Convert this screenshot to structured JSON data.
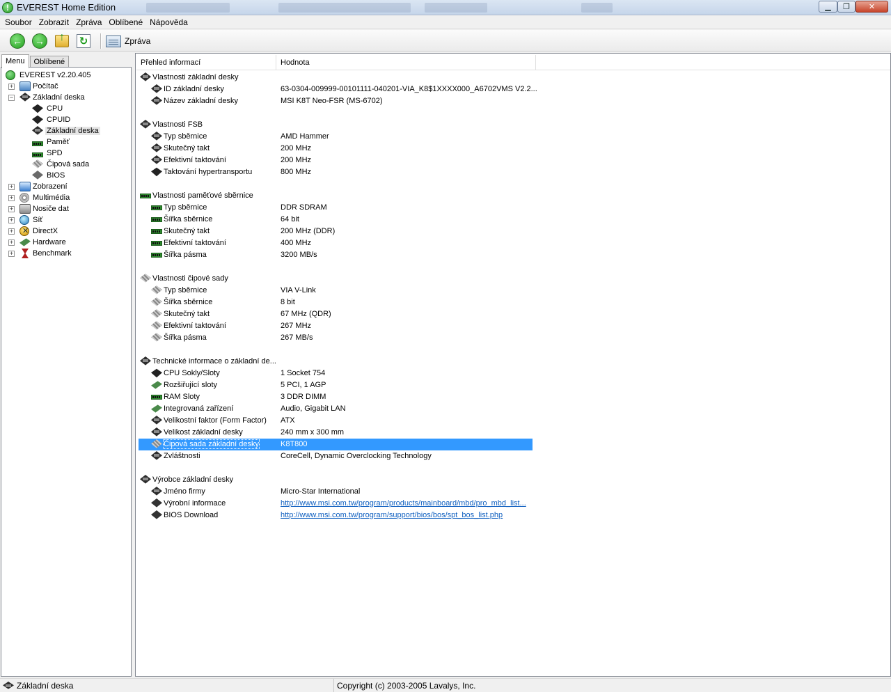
{
  "window": {
    "title": "EVEREST Home Edition"
  },
  "menubar": {
    "items": [
      {
        "label": "Soubor"
      },
      {
        "label": "Zobrazit"
      },
      {
        "label": "Zpráva"
      },
      {
        "label": "Oblíbené"
      },
      {
        "label": "Nápověda"
      }
    ]
  },
  "toolbar": {
    "report_label": "Zpráva"
  },
  "left": {
    "tabs": [
      {
        "label": "Menu"
      },
      {
        "label": "Oblíbené"
      }
    ],
    "tree": [
      {
        "label": "EVEREST v2.20.405",
        "icon": "everest-icon"
      },
      {
        "label": "Počítač",
        "icon": "computer-icon"
      },
      {
        "label": "Základní deska",
        "icon": "motherboard-icon"
      },
      {
        "label": "CPU",
        "icon": "cpu-icon"
      },
      {
        "label": "CPUID",
        "icon": "cpu-icon"
      },
      {
        "label": "Základní deska",
        "icon": "motherboard-icon"
      },
      {
        "label": "Paměť",
        "icon": "memory-icon"
      },
      {
        "label": "SPD",
        "icon": "memory-icon"
      },
      {
        "label": "Čipová sada",
        "icon": "chipset-icon"
      },
      {
        "label": "BIOS",
        "icon": "bios-icon"
      },
      {
        "label": "Zobrazení",
        "icon": "display-icon"
      },
      {
        "label": "Multimédia",
        "icon": "multimedia-icon"
      },
      {
        "label": "Nosiče dat",
        "icon": "storage-icon"
      },
      {
        "label": "Síť",
        "icon": "network-icon"
      },
      {
        "label": "DirectX",
        "icon": "directx-icon"
      },
      {
        "label": "Hardware",
        "icon": "hardware-icon"
      },
      {
        "label": "Benchmark",
        "icon": "benchmark-icon"
      }
    ]
  },
  "table": {
    "headers": {
      "field": "Přehled informací",
      "value": "Hodnota"
    },
    "sections": [
      {
        "title": "Vlastnosti základní desky",
        "rows": [
          {
            "field": "ID základní desky",
            "value": "63-0304-009999-00101111-040201-VIA_K8$1XXXX000_A6702VMS V2.2..."
          },
          {
            "field": "Název základní desky",
            "value": "MSI K8T Neo-FSR (MS-6702)"
          }
        ]
      },
      {
        "title": "Vlastnosti FSB",
        "rows": [
          {
            "field": "Typ sběrnice",
            "value": "AMD Hammer"
          },
          {
            "field": "Skutečný takt",
            "value": "200 MHz"
          },
          {
            "field": "Efektivní taktování",
            "value": "200 MHz"
          },
          {
            "field": "Taktování hypertransportu",
            "value": "800 MHz"
          }
        ]
      },
      {
        "title": "Vlastnosti paměťové sběrnice",
        "rows": [
          {
            "field": "Typ sběrnice",
            "value": "DDR SDRAM"
          },
          {
            "field": "Šířka sběrnice",
            "value": "64 bit"
          },
          {
            "field": "Skutečný takt",
            "value": "200 MHz (DDR)"
          },
          {
            "field": "Efektivní taktování",
            "value": "400 MHz"
          },
          {
            "field": "Šířka pásma",
            "value": "3200 MB/s"
          }
        ]
      },
      {
        "title": "Vlastnosti čipové sady",
        "rows": [
          {
            "field": "Typ sběrnice",
            "value": "VIA V-Link"
          },
          {
            "field": "Šířka sběrnice",
            "value": "8 bit"
          },
          {
            "field": "Skutečný takt",
            "value": "67 MHz (QDR)"
          },
          {
            "field": "Efektivní taktování",
            "value": "267 MHz"
          },
          {
            "field": "Šířka pásma",
            "value": "267 MB/s"
          }
        ]
      },
      {
        "title": "Technické informace o základní de...",
        "rows": [
          {
            "field": "CPU Sokly/Sloty",
            "value": "1 Socket 754"
          },
          {
            "field": "Rozšiřující sloty",
            "value": "5 PCI, 1 AGP"
          },
          {
            "field": "RAM Sloty",
            "value": "3 DDR DIMM"
          },
          {
            "field": "Integrovaná zařízení",
            "value": "Audio, Gigabit LAN"
          },
          {
            "field": "Velikostní faktor (Form Factor)",
            "value": "ATX"
          },
          {
            "field": "Velikost základní desky",
            "value": "240 mm x 300 mm"
          },
          {
            "field": "Čipová sada základní desky",
            "value": "K8T800"
          },
          {
            "field": "Zvláštnosti",
            "value": "CoreCell, Dynamic Overclocking Technology"
          }
        ]
      },
      {
        "title": "Výrobce základní desky",
        "rows": [
          {
            "field": "Jméno firmy",
            "value": "Micro-Star International"
          },
          {
            "field": "Výrobní informace",
            "value": "http://www.msi.com.tw/program/products/mainboard/mbd/pro_mbd_list..."
          },
          {
            "field": "BIOS Download",
            "value": "http://www.msi.com.tw/program/support/bios/bos/spt_bos_list.php"
          }
        ]
      }
    ]
  },
  "statusbar": {
    "left": "Základní deska",
    "right": "Copyright (c) 2003-2005 Lavalys, Inc."
  },
  "colors": {
    "selection": "#3399ff",
    "link": "#1060c0"
  }
}
